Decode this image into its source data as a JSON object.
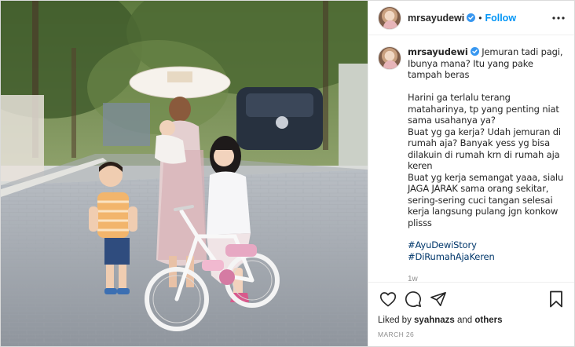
{
  "header": {
    "username": "mrsayudewi",
    "separator": "•",
    "follow_label": "Follow",
    "more_icon": "more-horizontal-icon",
    "verified_icon": "verified-badge-icon"
  },
  "photo": {
    "alt": "Three children with a bicycle on a street while a woman holds a baby under a round tray-hat"
  },
  "caption": {
    "username": "mrsayudewi",
    "text": "Jemuran tadi pagi, Ibunya mana? Itu yang pake tampah beras\n\nHarini ga terlalu terang mataharinya, tp yang penting niat sama usahanya ya?\nBuat yg ga kerja? Udah jemuran di rumah aja? Banyak yess yg bisa dilakuin di rumah krn di rumah aja keren\nBuat yg kerja semangat yaaa, sialu JAGA JARAK sama orang sekitar, sering-sering cuci tangan selesai kerja langsung pulang jgn konkow plisss",
    "hashtags": [
      "#AyuDewiStory",
      "#DiRumahAjaKeren"
    ],
    "time_ago": "1w"
  },
  "actions": {
    "like_icon": "heart-icon",
    "comment_icon": "comment-icon",
    "share_icon": "share-icon",
    "save_icon": "bookmark-icon"
  },
  "likes": {
    "prefix": "Liked by ",
    "user": "syahnazs",
    "suffix": " and ",
    "others": "others"
  },
  "date": "MARCH 26",
  "colors": {
    "accent": "#0095f6",
    "hashtag": "#00376b",
    "muted": "#8e8e8e",
    "text": "#262626"
  }
}
